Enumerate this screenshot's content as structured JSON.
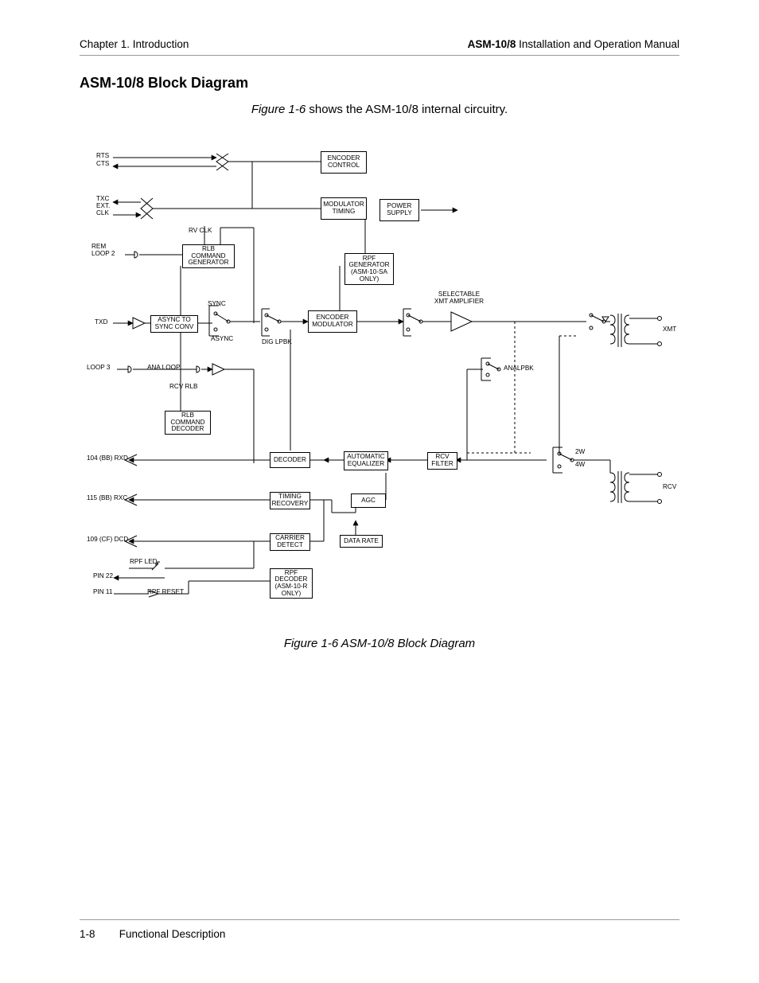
{
  "header": {
    "left": "Chapter 1.  Introduction",
    "right_bold": "ASM-10/8",
    "right_rest": " Installation and Operation Manual"
  },
  "section_title": "ASM-10/8 Block Diagram",
  "intro": {
    "fig_ref": "Figure 1-6",
    "rest": " shows the ASM-10/8 internal circuitry."
  },
  "caption": "Figure 1-6  ASM-10/8 Block Diagram",
  "footer": {
    "page": "1-8",
    "section": "Functional Description"
  },
  "blocks": {
    "encoder_control": "ENCODER\nCONTROL",
    "modulator_timing": "MODULATOR\nTIMING",
    "power_supply": "POWER\nSUPPLY",
    "rlb_cmd_gen": "RLB\nCOMMAND\nGENERATOR",
    "rpf_generator": "RPF\nGENERATOR\n(ASM-10-SA\nONLY)",
    "async_sync": "ASYNC TO\nSYNC CONV",
    "encoder_mod": "ENCODER\nMODULATOR",
    "rlb_cmd_dec": "RLB\nCOMMAND\nDECODER",
    "decoder": "DECODER",
    "auto_eq": "AUTOMATIC\nEQUALIZER",
    "rcv_filter": "RCV\nFILTER",
    "timing_rec": "TIMING\nRECOVERY",
    "agc": "AGC",
    "carrier_det": "CARRIER\nDETECT",
    "data_rate": "DATA RATE",
    "rpf_decoder": "RPF\nDECODER\n(ASM-10-R\nONLY)"
  },
  "labels": {
    "rts": "RTS",
    "cts": "CTS",
    "txc": "TXC",
    "ext": "EXT.",
    "clk": "CLK",
    "rv_clk": "RV CLK",
    "rem_loop2": "REM\nLOOP 2",
    "sync": "SYNC",
    "txd": "TXD",
    "async": "ASYNC",
    "dig_lpbk": "DIG LPBK",
    "sel_xmt": "SELECTABLE\nXMT AMPLIFIER",
    "loop3": "LOOP 3",
    "ana_loop": "ANA LOOP",
    "rcv_rlb": "RCV RLB",
    "analpbk": "ANALPBK",
    "rxd": "104 (BB) RXD",
    "rxc": "115 (BB) RXC",
    "dcd": "109 (CF) DCD",
    "rpf_led": "RPF LED",
    "pin22": "PIN 22",
    "pin11": "PIN 11",
    "rpf_reset": "RPF RESET",
    "xmt": "XMT",
    "rcv": "RCV",
    "2w": "2W",
    "4w": "4W"
  }
}
